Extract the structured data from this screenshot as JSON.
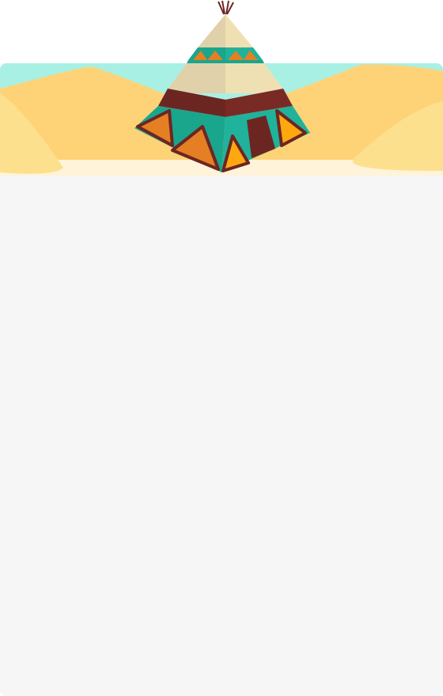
{
  "colors": {
    "sky": "#a9f0e4",
    "sand_dune": "#fed377",
    "sand_light": "#fde08e",
    "ground": "#fff3d9",
    "panel": "#f6f6f6",
    "tipi_canvas": "#efe0b4",
    "tipi_canvas_shade": "#e0d1aa",
    "tipi_teal": "#20b29b",
    "tipi_teal_dark": "#1aa58d",
    "tipi_maroon": "#6c2622",
    "tipi_orange": "#e57f24",
    "tipi_yellow": "#ffa70f"
  },
  "illustration": {
    "name": "desert-tipi-banner",
    "elements": [
      "sky",
      "sand-dunes",
      "tipi"
    ]
  }
}
